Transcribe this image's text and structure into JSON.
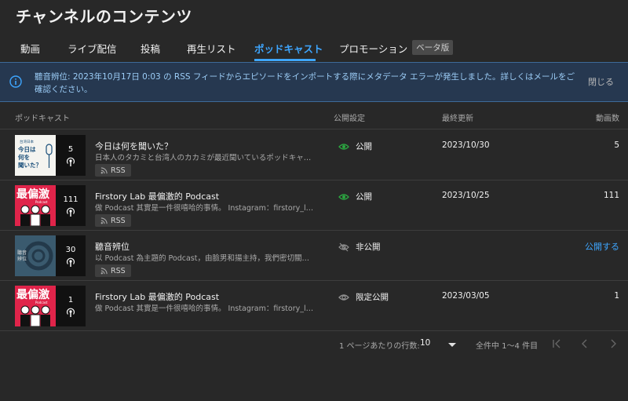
{
  "page_title": "チャンネルのコンテンツ",
  "tabs": [
    {
      "label": "動画"
    },
    {
      "label": "ライブ配信"
    },
    {
      "label": "投稿"
    },
    {
      "label": "再生リスト"
    },
    {
      "label": "ポッドキャスト",
      "active": true
    },
    {
      "label": "プロモーション",
      "badge": "ベータ版"
    }
  ],
  "banner": {
    "message": "聽音辨位: 2023年10月17日 0:03 の RSS フィードからエピソードをインポートする際にメタデータ エラーが発生しました。詳しくはメールをご確認ください。",
    "close_label": "閉じる",
    "icon": "info-icon"
  },
  "table": {
    "headers": {
      "podcast": "ポッドキャスト",
      "visibility": "公開設定",
      "last_updated": "最終更新",
      "video_count": "動画数"
    },
    "rows": [
      {
        "title": "今日は何を聞いた？",
        "description": "日本人のタカミと台湾人のカカミが最近聞いているポッドキャスト...",
        "episodes": "5",
        "rss": "RSS",
        "visibility": "公開",
        "visibility_icon": "eye-icon",
        "date": "2023/10/30",
        "count": "5",
        "thumb_text": "今日は何を聞いた？",
        "thumb_caption": "台湾日本"
      },
      {
        "title": "Firstory Lab 最偏激的 Podcast",
        "description": "做 Podcast 其實是一件很嘻哈的事情。 Instagram：firstory_lab...",
        "episodes": "111",
        "rss": "RSS",
        "visibility": "公開",
        "visibility_icon": "eye-icon",
        "date": "2023/10/25",
        "count": "111",
        "thumb_text": "最偏激",
        "thumb_caption": "Podcast"
      },
      {
        "title": "聽音辨位",
        "description": "以 Podcast 為主題的 Podcast，由臉男和揚主持，我們密切關注聲音...",
        "episodes": "30",
        "rss": "RSS",
        "visibility": "非公開",
        "visibility_icon": "eye-off-icon",
        "date": "",
        "count": "",
        "action": "公開する",
        "thumb_text": "聽音辨位"
      },
      {
        "title": "Firstory Lab 最偏激的 Podcast",
        "description": "做 Podcast 其實是一件很嘻哈的事情。 Instagram：firstory_lab",
        "episodes": "1",
        "rss": "",
        "visibility": "限定公開",
        "visibility_icon": "eye-icon",
        "date": "2023/03/05",
        "count": "1",
        "thumb_text": "最偏激",
        "thumb_caption": "Podcast"
      }
    ]
  },
  "pagination": {
    "rows_per_page_label": "1 ページあたりの行数:",
    "rows_per_page": "10",
    "range": "全件中 1〜4 件目"
  },
  "colors": {
    "accent": "#3ea6ff",
    "public_eye": "#2ba640",
    "banner_bg": "#263850"
  }
}
